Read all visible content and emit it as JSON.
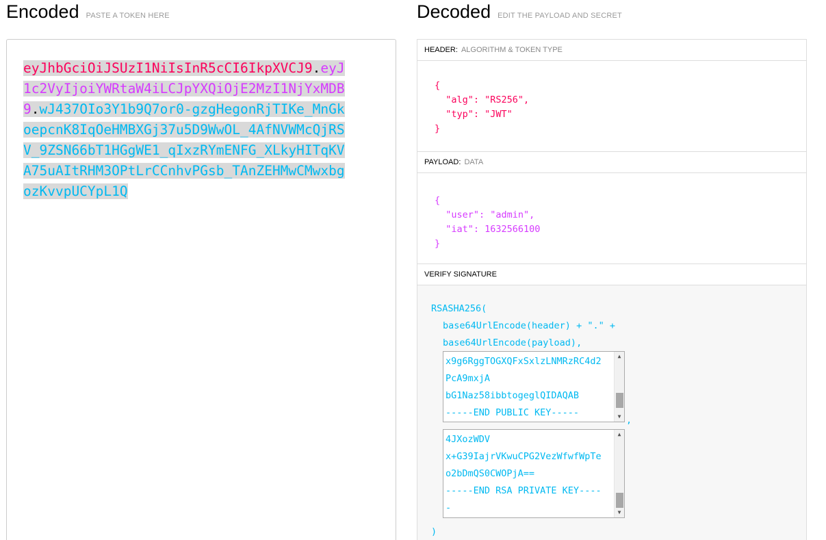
{
  "encoded": {
    "title": "Encoded",
    "subtitle": "PASTE A TOKEN HERE",
    "token_header": "eyJhbGciOiJSUzI1NiIsInR5cCI6IkpXVCJ9",
    "token_payload": "eyJ1c2VyIjoiYWRtaW4iLCJpYXQiOjE2MzI1NjYxMDB9",
    "token_signature": "wJ437OIo3Y1b9Q7or0-gzgHegonRjTIKe_MnGkoepcnK8IqOeHMBXGj37u5D9WwOL_4AfNVWMcQjRSV_9ZSN66bT1HGgWE1_qIxzRYmENFG_XLkyHITqKVA75uAItRHM3OPtLrCCnhvPGsb_TAnZEHMwCMwxbgozKvvpUCYpL1Q",
    "dot": "."
  },
  "decoded": {
    "title": "Decoded",
    "subtitle": "EDIT THE PAYLOAD AND SECRET"
  },
  "header_section": {
    "label": "HEADER:",
    "sublabel": "ALGORITHM & TOKEN TYPE",
    "json": "{\n  \"alg\": \"RS256\",\n  \"typ\": \"JWT\"\n}"
  },
  "payload_section": {
    "label": "PAYLOAD:",
    "sublabel": "DATA",
    "json": "{\n  \"user\": \"admin\",\n  \"iat\": 1632566100\n}"
  },
  "verify_section": {
    "label": "VERIFY SIGNATURE",
    "line1": "RSASHA256(",
    "line2": "base64UrlEncode(header) + \".\" +",
    "line3": "base64UrlEncode(payload),",
    "public_key": "x9g6RggTOGXQFxSxlzLNMRzRC4d2\nPcA9mxjA\nbG1Naz58ibbtogeglQIDAQAB\n-----END PUBLIC KEY-----",
    "comma": ",",
    "private_key": "4JXozWDV\nx+G39IajrVKwuCPG2VezWfwfWpTe\no2bDmQS0CWOPjA==\n-----END RSA PRIVATE KEY----\n-",
    "close": ")"
  },
  "colors": {
    "header": "#fb015b",
    "payload": "#d63aff",
    "signature": "#00b9f1"
  }
}
